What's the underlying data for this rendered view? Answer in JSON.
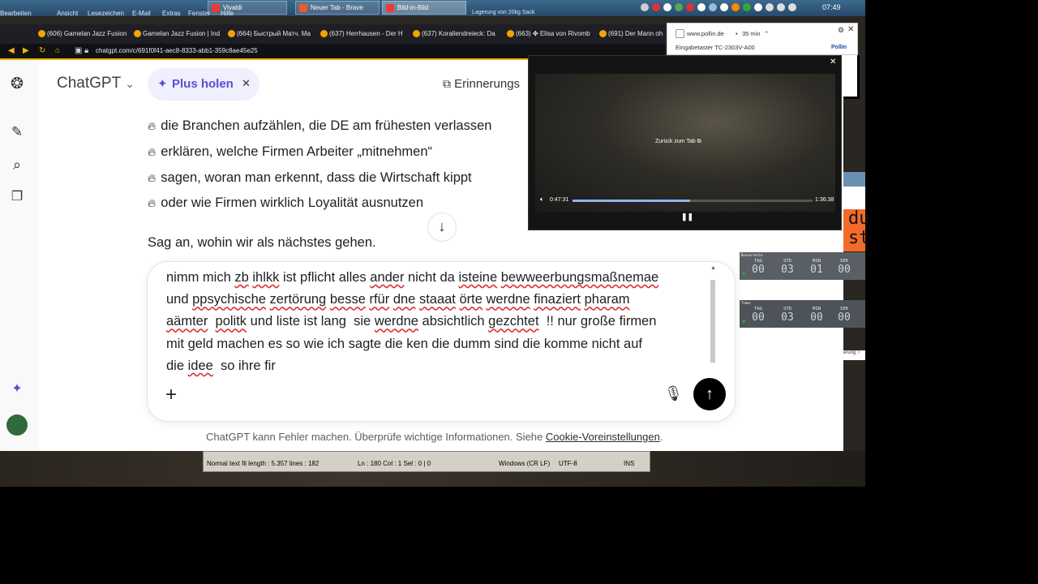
{
  "taskbar": {
    "menu": [
      "Bearbeiten",
      "Ansicht",
      "Lesezeichen",
      "E-Mail",
      "Extras",
      "Fenster",
      "Hilfe"
    ],
    "buttons": [
      {
        "label": "Vivaldi",
        "color": "#ef3939"
      },
      {
        "label": "Neuer Tab - Brave",
        "color": "#f05a24"
      },
      {
        "label": "Bild-in-Bild",
        "color": "#ef3939"
      }
    ],
    "banner": "Lagerung von 20kg Sack",
    "clock": "07:49"
  },
  "browser": {
    "tabs": [
      "(606) Gamelan Jazz Fusion",
      "Gamelan Jazz Fusion | Ind",
      "(664) Быстрый Матч. Ма",
      "(637) Herrhausen - Der H",
      "(637) Korallendreieck: Da",
      "(663) ✤ Elisa von Rivomb",
      "(691) Der Mann oh"
    ],
    "url": "chatgpt.com/c/691f0f41-aec8-8333-abb1-359c8ae45e25"
  },
  "notification": {
    "site": "www.pollin.de",
    "time": "35 min",
    "text": "Eingabetaster TC-2303V-A00",
    "logo": "Pollin"
  },
  "chatgpt": {
    "brand": "ChatGPT",
    "upgrade_label": "Plus holen",
    "reminders_label": "Erinnerungs",
    "bullets": [
      "die Branchen aufzählen, die DE am frühesten verlassen",
      "erklären, welche Firmen Arbeiter „mitnehmen“",
      "sagen, woran man erkennt, dass die Wirtschaft kippt",
      "oder wie Firmen wirklich Loyalität ausnutzen"
    ],
    "followup": "Sag an, wohin wir als nächstes gehen.",
    "composer_lines": [
      [
        {
          "t": "nimm mich "
        },
        {
          "t": "zb",
          "u": true
        },
        {
          "t": " "
        },
        {
          "t": "ihlkk",
          "u": true
        },
        {
          "t": " ist pflicht alles "
        },
        {
          "t": "ander",
          "u": true
        },
        {
          "t": " nicht da "
        },
        {
          "t": "isteine",
          "u": true
        },
        {
          "t": " "
        },
        {
          "t": "bewweerbungsmaßnemae",
          "u": true
        }
      ],
      [
        {
          "t": "und "
        },
        {
          "t": "ppsychische",
          "u": true
        },
        {
          "t": " "
        },
        {
          "t": "zertörung",
          "u": true
        },
        {
          "t": " "
        },
        {
          "t": "besse",
          "u": true
        },
        {
          "t": " "
        },
        {
          "t": "rfür",
          "u": true
        },
        {
          "t": " "
        },
        {
          "t": "dne",
          "u": true
        },
        {
          "t": " "
        },
        {
          "t": "staaat",
          "u": true
        },
        {
          "t": " "
        },
        {
          "t": "örte",
          "u": true
        },
        {
          "t": " "
        },
        {
          "t": "werdne",
          "u": true
        },
        {
          "t": " "
        },
        {
          "t": "finaziert",
          "u": true
        },
        {
          "t": " "
        },
        {
          "t": "pharam",
          "u": true
        }
      ],
      [
        {
          "t": "aämter",
          "u": true
        },
        {
          "t": "  "
        },
        {
          "t": "politk",
          "u": true
        },
        {
          "t": " und liste ist lang  sie "
        },
        {
          "t": "werdne",
          "u": true
        },
        {
          "t": " absichtlich "
        },
        {
          "t": "gezchtet",
          "u": true
        },
        {
          "t": "  !! nur große firmen"
        }
      ],
      [
        {
          "t": "mit geld machen es so wie ich sagte die ken die dumm sind die komme nicht auf"
        }
      ],
      [
        {
          "t": "die "
        },
        {
          "t": "idee",
          "u": true
        },
        {
          "t": "  so ihre fir"
        }
      ]
    ],
    "disclaimer": "ChatGPT kann Fehler machen. Überprüfe wichtige Informationen. Siehe",
    "disclaimer_link": "Cookie-Voreinstellungen",
    "disclaimer_end": "."
  },
  "pip": {
    "back_label": "Zurück zum Tab",
    "elapsed": "0:47:31",
    "total": "1:36:38",
    "progress": 0.49
  },
  "timers": [
    {
      "title": "Russerseite",
      "labels": [
        "TAG",
        "STD",
        "MIN",
        "SEK"
      ],
      "values": [
        "00",
        "03",
        "01",
        "00"
      ]
    },
    {
      "title": "Timer",
      "labels": [
        "TAG",
        "STD",
        "MIN",
        "SEK"
      ],
      "values": [
        "00",
        "03",
        "00",
        "00"
      ]
    }
  ],
  "side": {
    "orange_text": "du\nst",
    "tooltip": "erung: /"
  },
  "notepad": {
    "status": "Normal text fil  length : 5.357    lines : 182",
    "pos": "Ln : 180    Col : 1    Sel : 0 | 0",
    "eol": "Windows (CR LF)",
    "enc": "UTF-8",
    "ins": "INS"
  }
}
